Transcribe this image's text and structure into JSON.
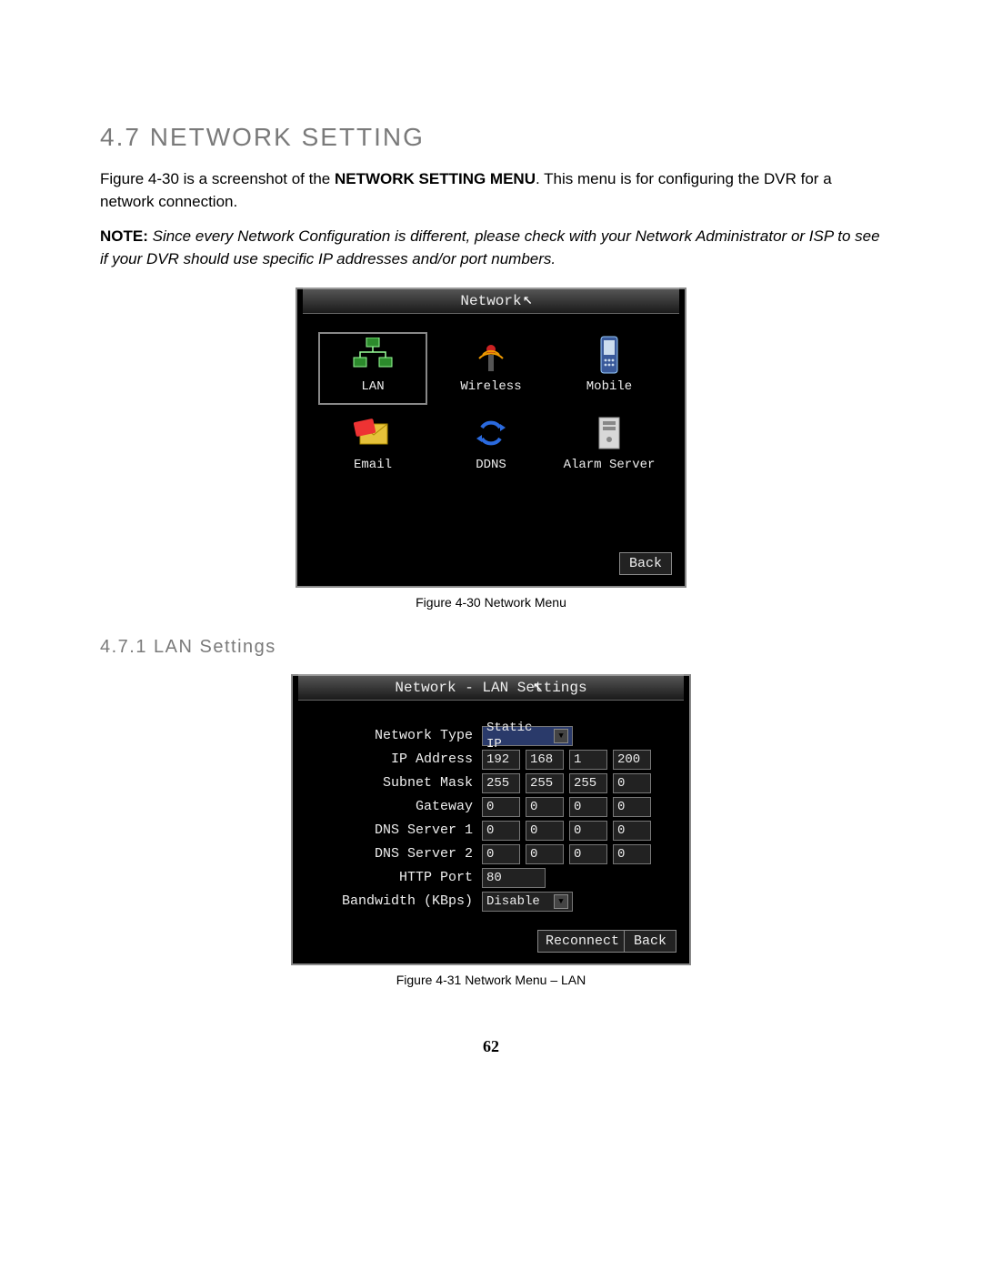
{
  "heading": "4.7  NETWORK SETTING",
  "para1_a": "Figure 4-30 is a screenshot of the ",
  "para1_b": "NETWORK SETTING MENU",
  "para1_c": ". This menu is for configuring the DVR for a network connection.",
  "note_label": "NOTE:",
  "note_body": " Since every Network Configuration is different, please check with your Network Administrator or ISP to see if your DVR should use specific IP addresses and/or port numbers.",
  "caption1": "Figure 4-30 Network Menu",
  "subheading": "4.7.1   LAN Settings",
  "caption2": "Figure 4-31 Network Menu – LAN",
  "page_number": "62",
  "fig1": {
    "title": "Network",
    "back": "Back",
    "items": [
      "LAN",
      "Wireless",
      "Mobile",
      "Email",
      "DDNS",
      "Alarm Server"
    ]
  },
  "fig2": {
    "title": "Network - LAN Settings",
    "reconnect": "Reconnect",
    "back": "Back",
    "labels": {
      "network_type": "Network Type",
      "ip_address": "IP Address",
      "subnet_mask": "Subnet Mask",
      "gateway": "Gateway",
      "dns1": "DNS Server 1",
      "dns2": "DNS Server 2",
      "http_port": "HTTP Port",
      "bandwidth": "Bandwidth (KBps)"
    },
    "values": {
      "network_type": "Static IP",
      "ip": [
        "192",
        "168",
        "1",
        "200"
      ],
      "mask": [
        "255",
        "255",
        "255",
        "0"
      ],
      "gateway": [
        "0",
        "0",
        "0",
        "0"
      ],
      "dns1": [
        "0",
        "0",
        "0",
        "0"
      ],
      "dns2": [
        "0",
        "0",
        "0",
        "0"
      ],
      "http_port": "80",
      "bandwidth": "Disable"
    }
  }
}
